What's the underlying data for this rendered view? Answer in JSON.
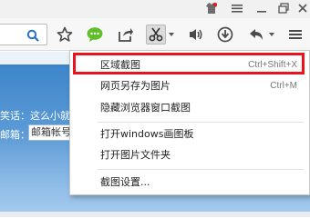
{
  "page": {
    "line1": "笑话：这么小就",
    "line2_label": "邮箱：",
    "mail_value": "邮箱帐号"
  },
  "icons": {
    "titlebar": [
      "shirt-icon",
      "menu-icon",
      "minimize-icon",
      "restore-icon",
      "close-icon"
    ],
    "toolbar": [
      "search-icon",
      "star-icon",
      "chat-icon",
      "share-icon",
      "scissors-icon",
      "volume-icon",
      "download-icon",
      "back-icon",
      "menu-icon"
    ]
  },
  "menu": {
    "items": [
      {
        "label": "区域截图",
        "shortcut": "Ctrl+Shift+X"
      },
      {
        "label": "网页另存为图片",
        "shortcut": "Ctrl+M"
      },
      {
        "label": "隐藏浏览器窗口截图",
        "shortcut": ""
      },
      {
        "label": "打开windows画图板",
        "shortcut": ""
      },
      {
        "label": "打开图片文件夹",
        "shortcut": ""
      },
      {
        "label": "截图设置...",
        "shortcut": ""
      }
    ]
  },
  "colors": {
    "highlight": "#e8131b",
    "accent_blue": "#3d82c6",
    "chat_green": "#5fbf2a"
  }
}
